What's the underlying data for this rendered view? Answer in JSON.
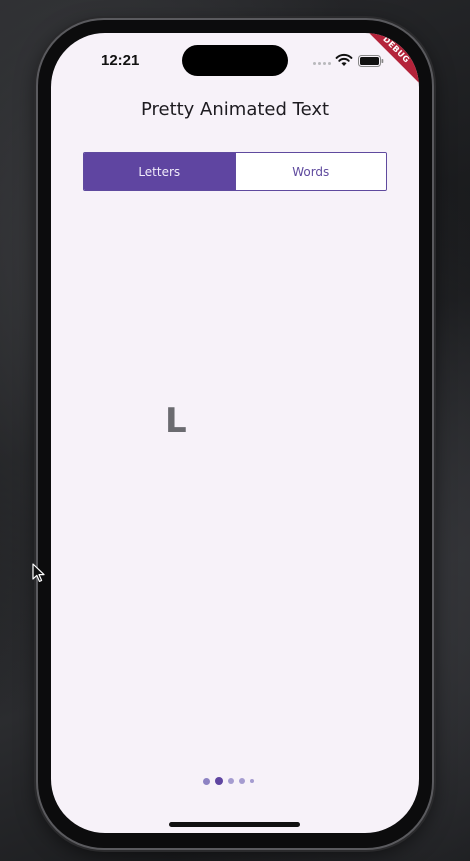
{
  "status_bar": {
    "time": "12:21",
    "debug_badge": "DEBUG"
  },
  "app": {
    "title": "Pretty Animated Text"
  },
  "segmented_control": {
    "options": [
      "Letters",
      "Words"
    ],
    "selected": "Letters"
  },
  "preview": {
    "visible_text": "L"
  },
  "pager": {
    "page_count": 5,
    "current_page": 2
  },
  "colors": {
    "accent": "#5f45a1",
    "background": "#f7f2f9",
    "inactive_dot": "#a59cd0"
  }
}
